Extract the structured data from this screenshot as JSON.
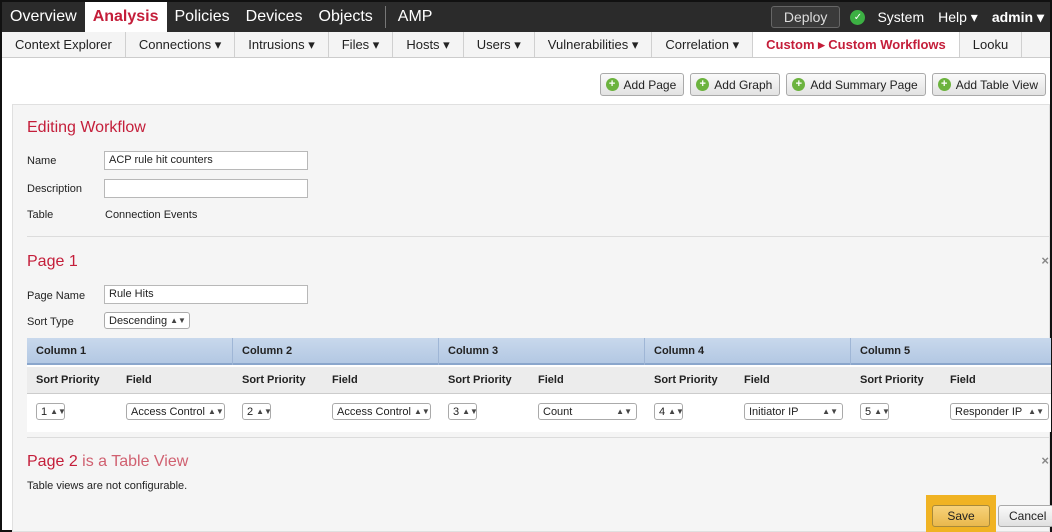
{
  "topnav": {
    "items": [
      "Overview",
      "Analysis",
      "Policies",
      "Devices",
      "Objects",
      "AMP"
    ],
    "deploy": "Deploy",
    "system": "System",
    "help": "Help ▾",
    "admin": "admin ▾"
  },
  "subnav": {
    "items": [
      "Context Explorer",
      "Connections ▾",
      "Intrusions ▾",
      "Files ▾",
      "Hosts ▾",
      "Users ▾",
      "Vulnerabilities ▾",
      "Correlation ▾",
      "Custom ▸ Custom Workflows",
      "Looku"
    ]
  },
  "actions": {
    "add_page": "Add Page",
    "add_graph": "Add Graph",
    "add_summary_page": "Add Summary Page",
    "add_table_view": "Add Table View"
  },
  "editing": {
    "title": "Editing Workflow",
    "name_label": "Name",
    "name_value": "ACP rule hit counters",
    "description_label": "Description",
    "description_value": "",
    "table_label": "Table",
    "table_value": "Connection Events"
  },
  "page1": {
    "title": "Page 1",
    "page_name_label": "Page Name",
    "page_name_value": "Rule Hits",
    "sort_type_label": "Sort Type",
    "sort_type_value": "Descending",
    "columns": [
      {
        "header": "Column 1",
        "priority_label": "Sort Priority",
        "field_label": "Field",
        "priority": "1",
        "field": "Access Control"
      },
      {
        "header": "Column 2",
        "priority_label": "Sort Priority",
        "field_label": "Field",
        "priority": "2",
        "field": "Access Control"
      },
      {
        "header": "Column 3",
        "priority_label": "Sort Priority",
        "field_label": "Field",
        "priority": "3",
        "field": "Count"
      },
      {
        "header": "Column 4",
        "priority_label": "Sort Priority",
        "field_label": "Field",
        "priority": "4",
        "field": "Initiator IP"
      },
      {
        "header": "Column 5",
        "priority_label": "Sort Priority",
        "field_label": "Field",
        "priority": "5",
        "field": "Responder IP"
      }
    ]
  },
  "page2": {
    "title_main": "Page 2",
    "title_rest": "is a Table View",
    "note": "Table views are not configurable."
  },
  "buttons": {
    "save": "Save",
    "cancel": "Cancel"
  },
  "colors": {
    "accent": "#c41e3a",
    "highlight": "#f0b323",
    "status_ok": "#3cb043"
  }
}
